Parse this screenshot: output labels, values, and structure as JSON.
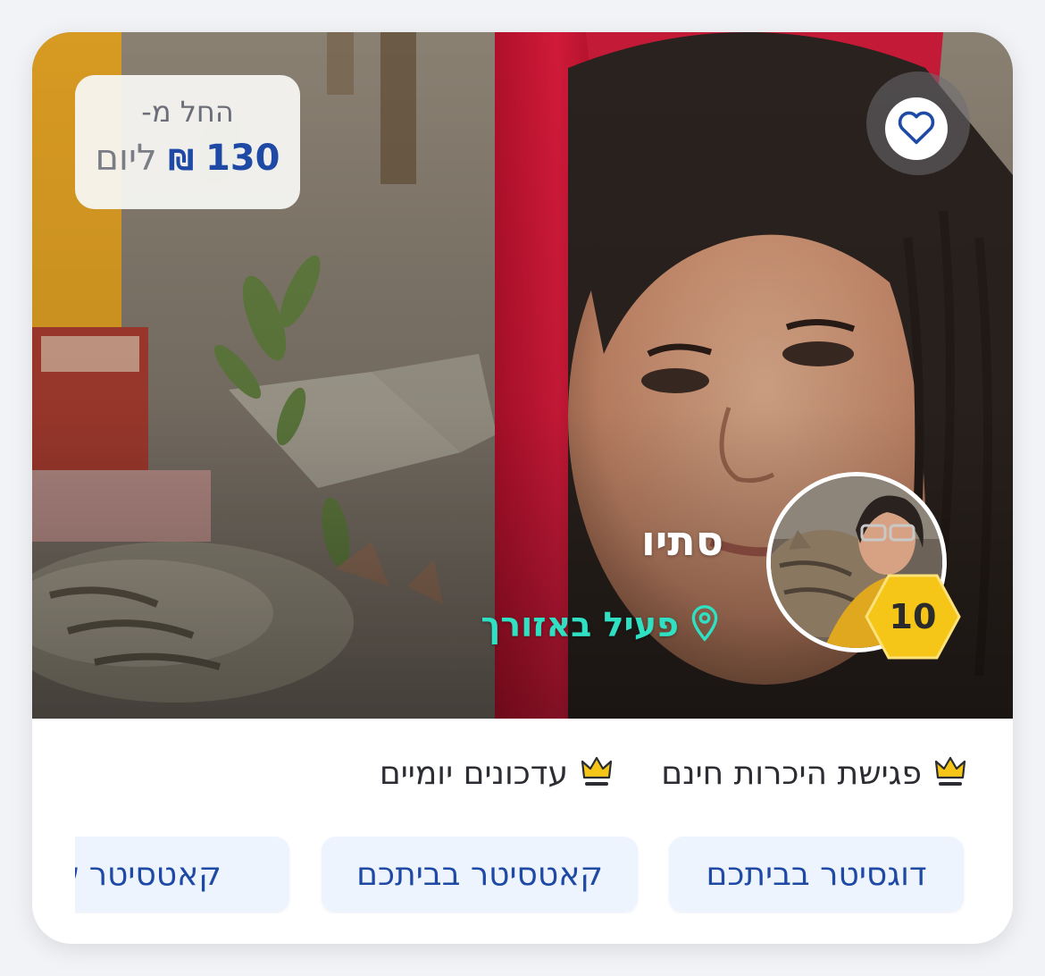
{
  "card": {
    "price": {
      "from_label": "החל מ-",
      "amount": "130",
      "currency": "₪",
      "per_label": "ליום"
    },
    "favorite": {
      "icon": "heart-outline-icon"
    },
    "sitter": {
      "name": "סתיו",
      "location_label": "פעיל באזורך",
      "location_icon": "map-pin-icon",
      "level": "10"
    },
    "perks": [
      {
        "icon": "crown-icon",
        "label": "פגישת היכרות חינם"
      },
      {
        "icon": "crown-icon",
        "label": "עדכונים יומיים"
      }
    ],
    "tags": [
      {
        "label": "דוגסיטר בביתכם"
      },
      {
        "label": "קאטסיטר בביתכם"
      },
      {
        "label": "קאטסיטר שע"
      }
    ],
    "colors": {
      "accent_blue": "#1e4aa6",
      "location_teal": "#2fe0c2",
      "level_badge": "#f5c518",
      "tag_background": "#eef4fd"
    }
  }
}
